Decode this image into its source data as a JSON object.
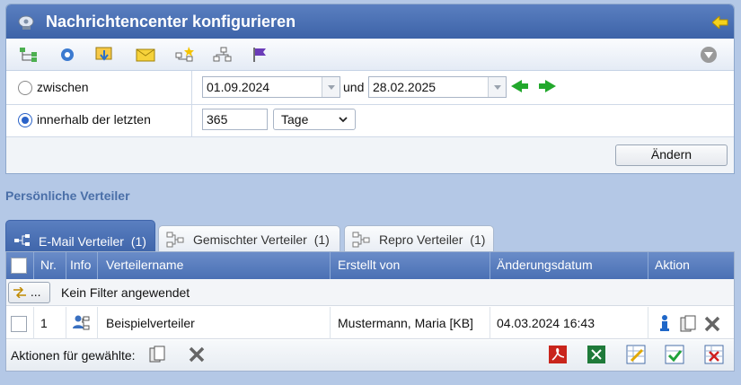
{
  "window": {
    "title": "Nachrichtencenter konfigurieren"
  },
  "filter": {
    "between_label": "zwischen",
    "date_from": "01.09.2024",
    "and_label": "und",
    "date_to": "28.02.2025",
    "within_label": "innerhalb der letzten",
    "within_value": "365",
    "unit_value": "Tage",
    "change_button": "Ändern"
  },
  "section": {
    "title": "Persönliche Verteiler"
  },
  "tabs": [
    {
      "label": "E-Mail Verteiler",
      "count": "(1)",
      "active": true
    },
    {
      "label": "Gemischter Verteiler",
      "count": "(1)",
      "active": false
    },
    {
      "label": "Repro Verteiler",
      "count": "(1)",
      "active": false
    }
  ],
  "grid": {
    "columns": [
      "Nr.",
      "Info",
      "Verteilername",
      "Erstellt von",
      "Änderungsdatum",
      "Aktion"
    ],
    "filter_button": "...",
    "filter_text": "Kein Filter angewendet",
    "rows": [
      {
        "nr": "1",
        "name": "Beispielverteiler",
        "created_by": "Mustermann, Maria [KB]",
        "changed": "04.03.2024 16:43"
      }
    ],
    "footer_label": "Aktionen für gewählte:"
  },
  "colors": {
    "header": "#4a70b4",
    "section_title": "#4a6fa8",
    "nav_arrow": "#22a82c"
  }
}
